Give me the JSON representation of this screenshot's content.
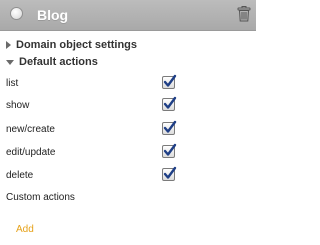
{
  "panel": {
    "title": "Blog"
  },
  "sections": {
    "domain_settings": "Domain object settings",
    "default_actions": "Default actions"
  },
  "actions": [
    {
      "label": "list",
      "checked": true
    },
    {
      "label": "show",
      "checked": true
    },
    {
      "label": "new/create",
      "checked": true
    },
    {
      "label": "edit/update",
      "checked": true
    },
    {
      "label": "delete",
      "checked": true
    }
  ],
  "custom_actions_label": "Custom actions",
  "add_label": "Add",
  "colors": {
    "header": "#b3b3b3",
    "link": "#e6a21a",
    "check": "#1f3f86"
  },
  "icons": {
    "header_left": "radio-circle-icon",
    "header_right": "trash-icon",
    "collapsed": "triangle-right-icon",
    "expanded": "triangle-down-icon"
  }
}
